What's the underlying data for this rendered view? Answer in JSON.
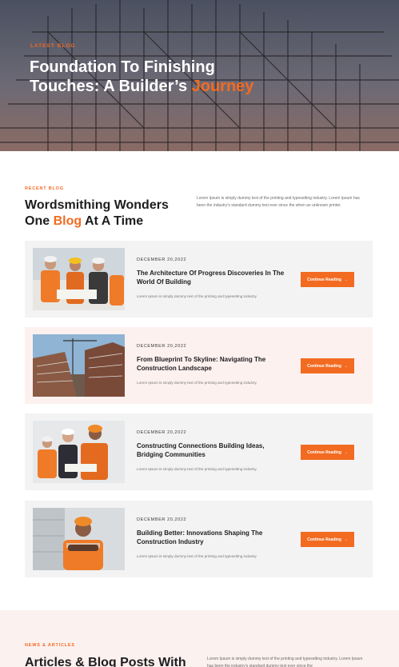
{
  "hero": {
    "eyebrow": "LATEST BLOG",
    "title_line1": "Foundation To Finishing",
    "title_line2_prefix": "Touches: A Builder’s ",
    "title_accent": "Journey"
  },
  "recent": {
    "eyebrow": "RECENT BLOG",
    "title_line1": "Wordsmithing Wonders",
    "title_line2_prefix": "One ",
    "title_accent": "Blog",
    "title_line2_suffix": " At A Time",
    "description": "Lorem Ipsum is simply dummy text of the printing and typesetting industry. Lorem Ipsum has been the industry's standard dummy text ever since the when an unknown printer."
  },
  "posts": [
    {
      "date": "DECEMBER 20,2022",
      "title": "The Architecture Of Progress Discoveries In The World Of Building",
      "excerpt": "Lorem Ipsum is simply dummy text of the printing and typesetting industry.",
      "button": "Continue Reading"
    },
    {
      "date": "DECEMBER 20,2022",
      "title": "From Blueprint To Skyline: Navigating The Construction Landscape",
      "excerpt": "Lorem Ipsum is simply dummy text of the printing and typesetting industry.",
      "button": "Continue Reading"
    },
    {
      "date": "DECEMBER 20,2022",
      "title": "Constructing Connections Building Ideas, Bridging Communities",
      "excerpt": "Lorem Ipsum is simply dummy text of the printing and typesetting industry.",
      "button": "Continue Reading"
    },
    {
      "date": "DECEMBER 20,2022",
      "title": "Building Better: Innovations Shaping The Construction Industry",
      "excerpt": "Lorem Ipsum is simply dummy text of the printing and typesetting industry.",
      "button": "Continue Reading"
    }
  ],
  "news": {
    "eyebrow": "NEWS & ARTICLES",
    "title": "Articles & Blog Posts With",
    "description": "Lorem Ipsum is simply dummy text of the printing and typesetting industry. Lorem Ipsum has been the industry's standard dummy text ever since the"
  },
  "colors": {
    "accent": "#f26b21",
    "card_gray": "#f3f3f3",
    "card_pink": "#fdf1ef"
  },
  "icons": {
    "button_arrow": "arrow-right-icon"
  }
}
